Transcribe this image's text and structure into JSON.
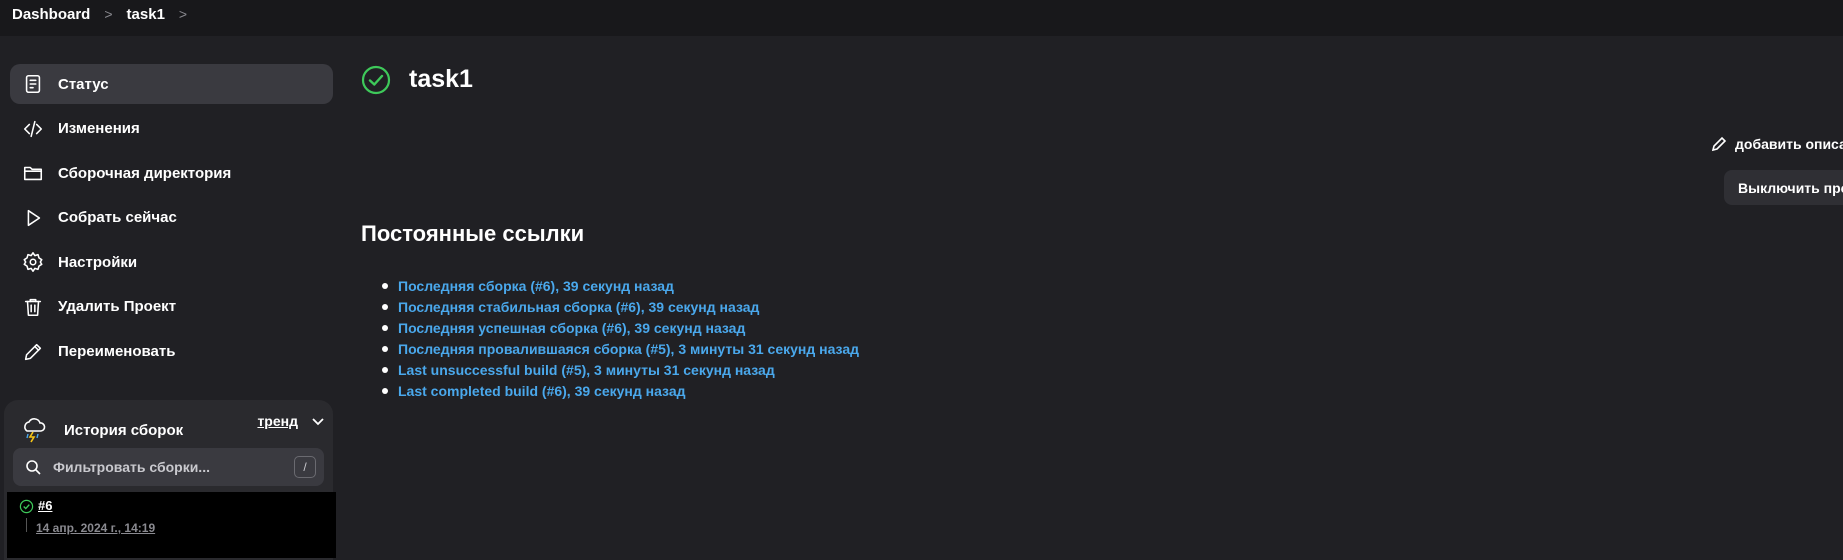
{
  "breadcrumb": {
    "items": [
      "Dashboard",
      "task1"
    ],
    "separator": ">"
  },
  "sidebar": {
    "items": [
      {
        "label": "Статус",
        "icon": "document-icon",
        "active": true
      },
      {
        "label": "Изменения",
        "icon": "code-icon"
      },
      {
        "label": "Сборочная директория",
        "icon": "folder-icon"
      },
      {
        "label": "Собрать сейчас",
        "icon": "play-icon"
      },
      {
        "label": "Настройки",
        "icon": "gear-icon"
      },
      {
        "label": "Удалить Проект",
        "icon": "trash-icon"
      },
      {
        "label": "Переименовать",
        "icon": "pencil-icon"
      }
    ]
  },
  "history": {
    "title": "История сборок",
    "trend_label": "тренд",
    "search_placeholder": "Фильтровать сборки...",
    "shortcut": "/",
    "builds": [
      {
        "number": "#6",
        "date": "14 апр. 2024 г., 14:19",
        "status": "success"
      }
    ]
  },
  "main": {
    "title": "task1",
    "status": "success",
    "add_description": "добавить описан",
    "disable_button": "Выключить прое",
    "permalinks_title": "Постоянные ссылки",
    "permalinks": [
      "Последняя сборка (#6), 39 секунд назад",
      "Последняя стабильная сборка (#6), 39 секунд назад",
      "Последняя успешная сборка (#6), 39 секунд назад",
      "Последняя провалившаяся сборка (#5), 3 минуты 31 секунд назад",
      "Last unsuccessful build (#5), 3 минуты 31 секунд назад",
      "Last completed build (#6), 39 секунд назад"
    ]
  },
  "colors": {
    "background": "#202024",
    "topbar": "#18181b",
    "link": "#4aa8ec",
    "success": "#3ec95a",
    "active_item": "#3a3a40"
  }
}
